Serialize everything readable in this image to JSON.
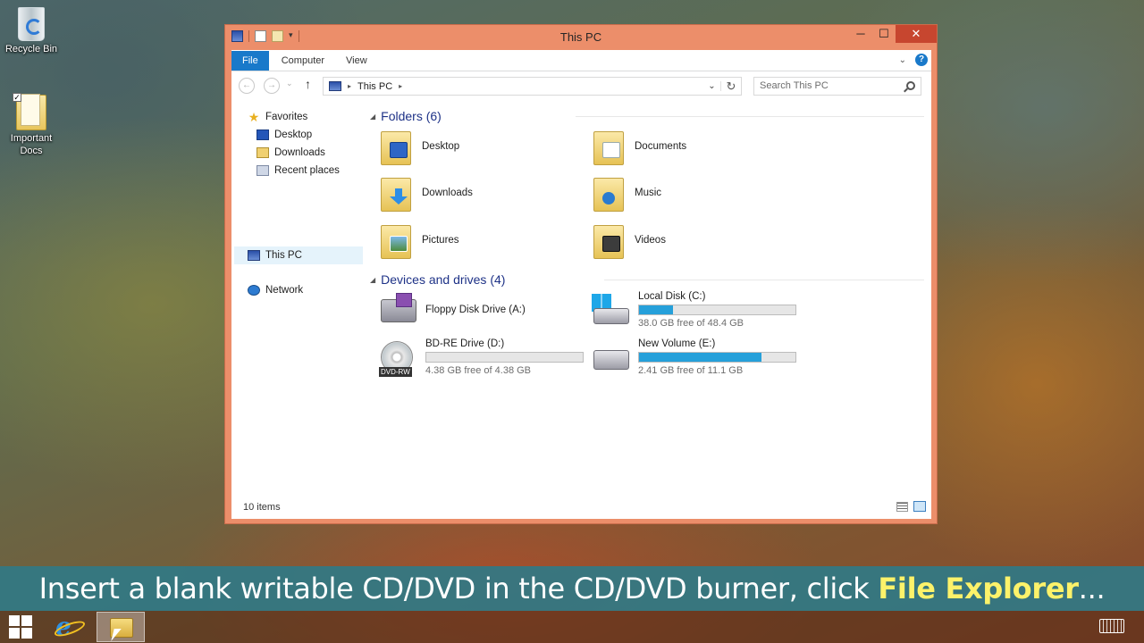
{
  "desktop": {
    "icons": [
      {
        "label": "Recycle Bin",
        "icon": "recycle-bin-icon"
      },
      {
        "label": "Important Docs",
        "icon": "folder-icon"
      }
    ]
  },
  "window": {
    "title": "This PC",
    "controls": {
      "minimize": "─",
      "maximize": "☐",
      "close": "✕"
    },
    "ribbon": {
      "tabs": [
        "File",
        "Computer",
        "View"
      ],
      "help": "?",
      "expand": "⌄"
    },
    "nav": {
      "back": "←",
      "forward": "→",
      "recent": "⌄",
      "up": "↑",
      "address_root_sep": "▸",
      "address_location": "This PC",
      "address_tail_sep": "▸",
      "address_dropdown": "⌄",
      "refresh": "↻",
      "search_placeholder": "Search This PC"
    },
    "navpane": {
      "favorites": "Favorites",
      "favorites_items": [
        "Desktop",
        "Downloads",
        "Recent places"
      ],
      "this_pc": "This PC",
      "network": "Network"
    },
    "folders_group": {
      "label": "Folders (6)",
      "items": [
        "Desktop",
        "Documents",
        "Downloads",
        "Music",
        "Pictures",
        "Videos"
      ]
    },
    "drives_group": {
      "label": "Devices and drives (4)",
      "items": [
        {
          "name": "Floppy Disk Drive (A:)",
          "free": "",
          "used_fraction": null
        },
        {
          "name": "Local Disk (C:)",
          "free": "38.0 GB free of 48.4 GB",
          "used_fraction": 0.215
        },
        {
          "name": "BD-RE Drive (D:)",
          "free": "4.38 GB free of 4.38 GB",
          "used_fraction": 0.0,
          "disc_label": "DVD-RW"
        },
        {
          "name": "New Volume (E:)",
          "free": "2.41 GB free of 11.1 GB",
          "used_fraction": 0.783
        }
      ]
    },
    "status": {
      "count": "10 items"
    }
  },
  "caption": {
    "text": "Insert a blank writable CD/DVD in the CD/DVD burner, click ",
    "highlight": "File Explorer",
    "suffix": "..."
  },
  "colors": {
    "window_frame": "#ec8e6a",
    "close_button": "#c7462f",
    "file_tab": "#1979ca",
    "drive_bar": "#26a0da",
    "caption_bg": "#3178884",
    "caption_highlight": "#fcf26a"
  }
}
